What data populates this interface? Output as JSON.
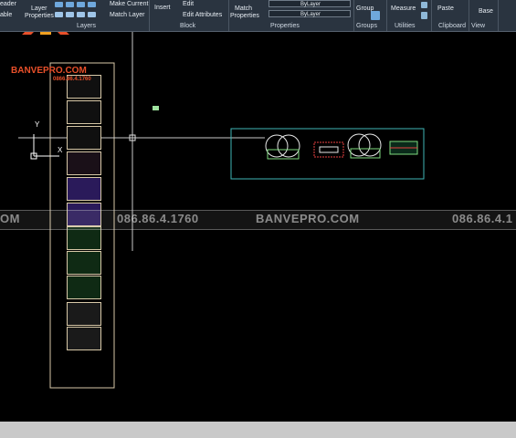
{
  "ribbon": {
    "row1": {
      "header": "eader",
      "layer": "Layer",
      "make_current": "Make Current",
      "insert": "Insert",
      "edit": "Edit",
      "match": "Match",
      "bylayer1": "ByLayer",
      "group": "Group",
      "measure": "Measure",
      "paste": "Paste",
      "base": "Base"
    },
    "row2": {
      "table": "able",
      "properties": "Properties",
      "match_layer": "Match Layer",
      "edit_attributes": "Edit Attributes",
      "match_properties": "Properties",
      "bylayer2": "ByLayer"
    },
    "panels": {
      "layers": "Layers",
      "block": "Block",
      "properties": "Properties",
      "groups": "Groups",
      "utilities": "Utilities",
      "clipboard": "Clipboard",
      "view": "View"
    }
  },
  "canvas": {
    "logo_text": "BANVEPRO.COM",
    "logo_phone": "0866.86.4.1760",
    "watermark_left": "OM",
    "watermark_phone1": "086.86.4.1760",
    "watermark_site": "BANVEPRO.COM",
    "watermark_phone2": "086.86.4.1",
    "ucs_y": "Y",
    "ucs_x": "X"
  },
  "colors": {
    "ribbon_bg": "#2a3440",
    "canvas_bg": "#000000",
    "frame": "#d8c9a8",
    "cyan_frame": "#3fb6b6",
    "logo": "#e8502a"
  }
}
